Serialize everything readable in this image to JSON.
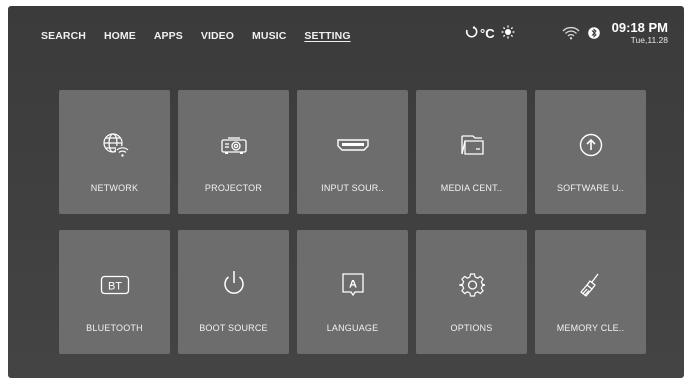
{
  "nav": {
    "items": [
      {
        "label": "SEARCH"
      },
      {
        "label": "HOME"
      },
      {
        "label": "APPS"
      },
      {
        "label": "VIDEO"
      },
      {
        "label": "MUSIC"
      },
      {
        "label": "SETTING",
        "active": true
      }
    ]
  },
  "status": {
    "temperature_unit": "°C",
    "time": "09:18 PM",
    "date": "Tue,11.28",
    "icons": [
      "thermometer-icon",
      "sun-icon",
      "wifi-icon",
      "bluetooth-icon"
    ]
  },
  "tiles": [
    {
      "label": "NETWORK",
      "icon": "network-globe-wifi-icon"
    },
    {
      "label": "PROJECTOR",
      "icon": "projector-icon"
    },
    {
      "label": "INPUT SOUR..",
      "icon": "hdmi-port-icon"
    },
    {
      "label": "MEDIA CENT..",
      "icon": "media-folder-icon"
    },
    {
      "label": "SOFTWARE U..",
      "icon": "upload-arrow-circle-icon"
    },
    {
      "label": "BLUETOOTH",
      "icon": "bt-badge-icon"
    },
    {
      "label": "BOOT SOURCE",
      "icon": "power-icon"
    },
    {
      "label": "LANGUAGE",
      "icon": "language-a-icon"
    },
    {
      "label": "OPTIONS",
      "icon": "gear-icon"
    },
    {
      "label": "MEMORY CLE..",
      "icon": "broom-clean-icon"
    }
  ],
  "colors": {
    "background": "#3f3f3f",
    "tile": "#6d6d6d",
    "text": "#f2f2f2"
  }
}
